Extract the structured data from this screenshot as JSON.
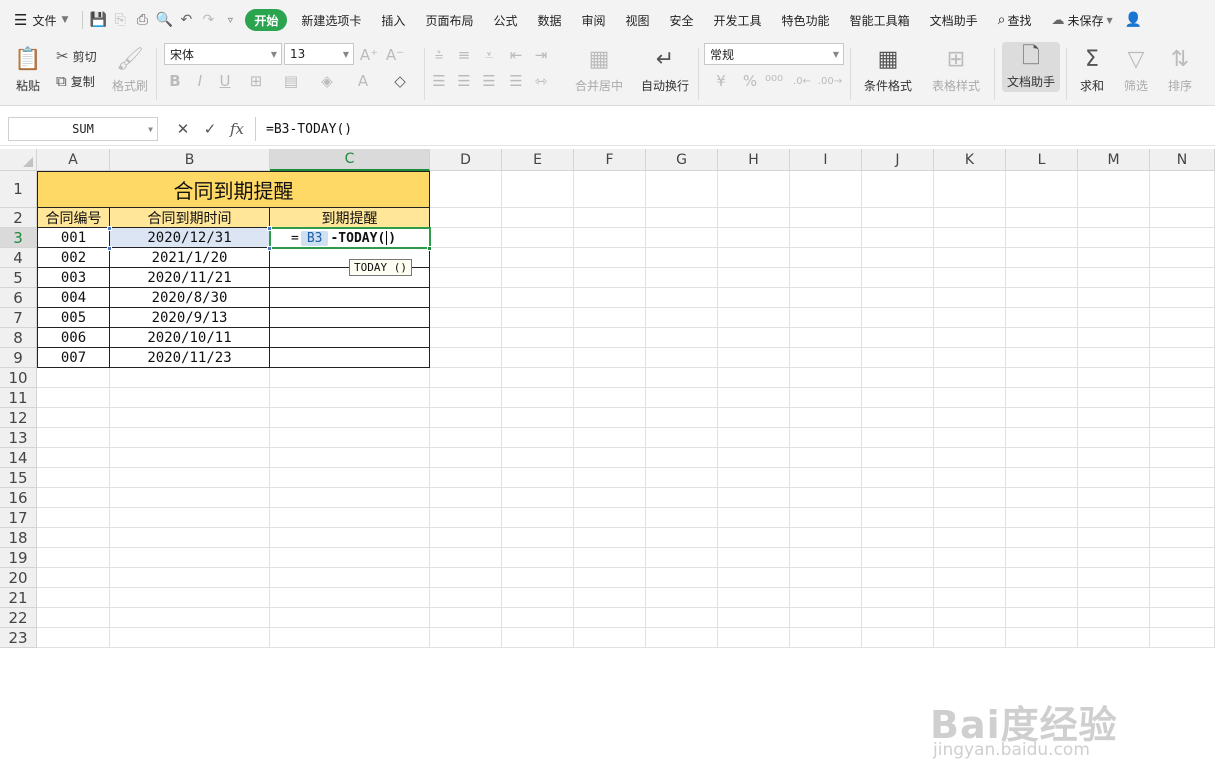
{
  "menu": {
    "file_label": "文件",
    "tabs": [
      "开始",
      "新建选项卡",
      "插入",
      "页面布局",
      "公式",
      "数据",
      "审阅",
      "视图",
      "安全",
      "开发工具",
      "特色功能",
      "智能工具箱",
      "文档助手"
    ],
    "active_tab": "开始",
    "search_label": "查找",
    "save_status": "未保存",
    "accent_color": "#2aa44f"
  },
  "ribbon": {
    "paste_label": "粘贴",
    "cut_label": "剪切",
    "copy_label": "复制",
    "format_painter_label": "格式刷",
    "font_name": "宋体",
    "font_size": "13",
    "number_format": "常规",
    "merge_center_label": "合并居中",
    "wrap_text_label": "自动换行",
    "conditional_format_label": "条件格式",
    "table_style_label": "表格样式",
    "doc_assistant_label": "文档助手",
    "sum_label": "求和",
    "filter_label": "筛选",
    "sort_label": "排序"
  },
  "formula_bar": {
    "name_box": "SUM",
    "fx_label": "fx",
    "formula": "=B3-TODAY()"
  },
  "columns": [
    "A",
    "B",
    "C",
    "D",
    "E",
    "F",
    "G",
    "H",
    "I",
    "J",
    "K",
    "L",
    "M",
    "N"
  ],
  "rows": [
    "1",
    "2",
    "3",
    "4",
    "5",
    "6",
    "7",
    "8",
    "9",
    "10",
    "11",
    "12",
    "13",
    "14",
    "15",
    "16",
    "17",
    "18",
    "19",
    "20",
    "21",
    "22",
    "23"
  ],
  "sheet": {
    "title": "合同到期提醒",
    "headers": [
      "合同编号",
      "合同到期时间",
      "到期提醒"
    ],
    "records": [
      {
        "id": "001",
        "date": "2020/12/31"
      },
      {
        "id": "002",
        "date": "2021/1/20"
      },
      {
        "id": "003",
        "date": "2020/11/21"
      },
      {
        "id": "004",
        "date": "2020/8/30"
      },
      {
        "id": "005",
        "date": "2020/9/13"
      },
      {
        "id": "006",
        "date": "2020/10/11"
      },
      {
        "id": "007",
        "date": "2020/11/23"
      }
    ],
    "editing": {
      "eq": "=",
      "ref": "B3",
      "rest": "-TODAY(",
      "close": ")"
    },
    "tooltip": "TODAY ()"
  },
  "watermark": {
    "main": "Bai度经验",
    "sub": "jingyan.baidu.com"
  }
}
